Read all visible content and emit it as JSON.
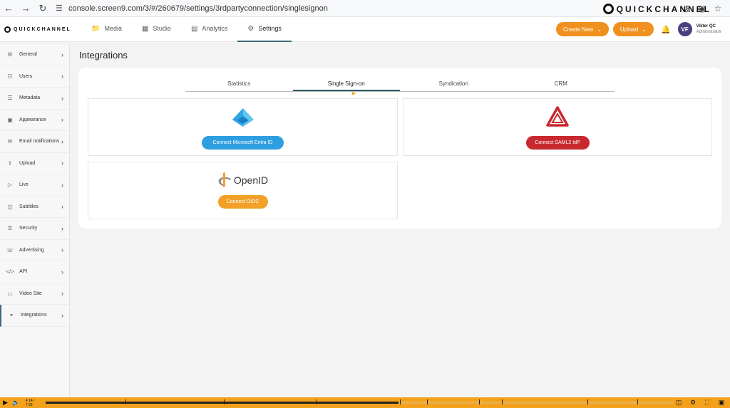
{
  "browser": {
    "url": "console.screen9.com/3/#/260679/settings/3rdpartyconnection/singlesignon",
    "watermark": "QUICKCHANNEL"
  },
  "header": {
    "brand": "QUICKCHANNEL",
    "nav": [
      {
        "label": "Media",
        "icon": "folder-icon"
      },
      {
        "label": "Studio",
        "icon": "studio-icon"
      },
      {
        "label": "Analytics",
        "icon": "chart-icon"
      },
      {
        "label": "Settings",
        "icon": "gear-icon",
        "active": true
      }
    ],
    "create_new": "Create New",
    "upload": "Upload",
    "avatar_initials": "VF",
    "user_name": "Vikter QC",
    "user_role": "Administrator"
  },
  "sidebar": {
    "items": [
      {
        "label": "General",
        "icon": "gear-icon"
      },
      {
        "label": "Users",
        "icon": "users-icon"
      },
      {
        "label": "Metadata",
        "icon": "list-icon"
      },
      {
        "label": "Appearance",
        "icon": "image-icon"
      },
      {
        "label": "Email notifications",
        "icon": "mail-icon"
      },
      {
        "label": "Upload",
        "icon": "upload-icon"
      },
      {
        "label": "Live",
        "icon": "live-icon"
      },
      {
        "label": "Subtitles",
        "icon": "cc-icon"
      },
      {
        "label": "Security",
        "icon": "lock-icon"
      },
      {
        "label": "Advertising",
        "icon": "megaphone-icon"
      },
      {
        "label": "API",
        "icon": "code-icon"
      },
      {
        "label": "Video Site",
        "icon": "monitor-icon"
      },
      {
        "label": "Integrations",
        "icon": "plug-icon",
        "active": true
      }
    ]
  },
  "main": {
    "title": "Integrations",
    "tabs": [
      {
        "label": "Statistics"
      },
      {
        "label": "Single Sign-on",
        "active": true
      },
      {
        "label": "Syndication"
      },
      {
        "label": "CRM"
      }
    ],
    "providers": {
      "entra": {
        "button": "Connect Microsoft Entra ID",
        "color": "#2d9ee0"
      },
      "saml": {
        "button": "Connect SAML2 IdP",
        "color": "#c8292f"
      },
      "oidc": {
        "logo_text": "OpenID",
        "button": "Connect OIDC",
        "color": "#f2a126"
      }
    }
  },
  "player": {
    "time": "4:14 / 7:32",
    "progress": 0.563
  }
}
